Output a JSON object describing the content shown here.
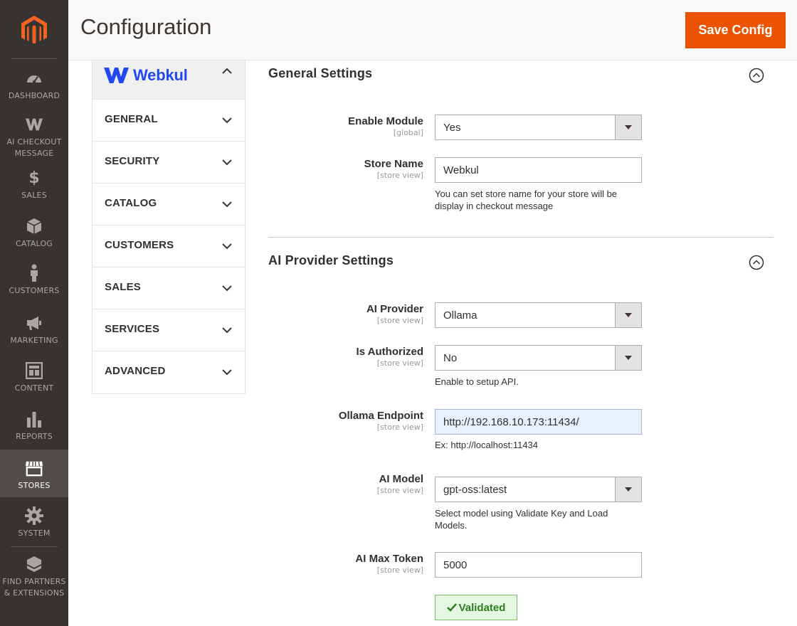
{
  "menu": {
    "items": [
      {
        "label": "DASHBOARD",
        "icon": "dashboard-icon"
      },
      {
        "label": "AI CHECKOUT MESSAGE",
        "icon": "webkul-w-icon"
      },
      {
        "label": "SALES",
        "icon": "dollar-icon"
      },
      {
        "label": "CATALOG",
        "icon": "box-icon"
      },
      {
        "label": "CUSTOMERS",
        "icon": "person-icon"
      },
      {
        "label": "MARKETING",
        "icon": "megaphone-icon"
      },
      {
        "label": "CONTENT",
        "icon": "layout-icon"
      },
      {
        "label": "REPORTS",
        "icon": "bar-chart-icon"
      },
      {
        "label": "STORES",
        "icon": "storefront-icon"
      },
      {
        "label": "SYSTEM",
        "icon": "gear-icon"
      },
      {
        "label": "FIND PARTNERS & EXTENSIONS",
        "icon": "extensions-icon"
      }
    ],
    "active": "STORES"
  },
  "header": {
    "title": "Configuration",
    "save_label": "Save Config"
  },
  "tabs": {
    "brand": "Webkul",
    "items": [
      "GENERAL",
      "SECURITY",
      "CATALOG",
      "CUSTOMERS",
      "SALES",
      "SERVICES",
      "ADVANCED"
    ]
  },
  "general": {
    "title": "General Settings",
    "enable_module": {
      "label": "Enable Module",
      "scope": "[global]",
      "value": "Yes"
    },
    "store_name": {
      "label": "Store Name",
      "scope": "[store view]",
      "value": "Webkul",
      "note": "You can set store name for your store will be display in checkout message"
    }
  },
  "ai": {
    "title": "AI Provider Settings",
    "provider": {
      "label": "AI Provider",
      "scope": "[store view]",
      "value": "Ollama"
    },
    "authorized": {
      "label": "Is Authorized",
      "scope": "[store view]",
      "value": "No",
      "note": "Enable to setup API."
    },
    "endpoint": {
      "label": "Ollama Endpoint",
      "scope": "[store view]",
      "value": "http://192.168.10.173:11434/",
      "note": "Ex: http://localhost:11434"
    },
    "model": {
      "label": "AI Model",
      "scope": "[store view]",
      "value": "gpt-oss:latest",
      "note": "Select model using Validate Key and Load Models."
    },
    "max_token": {
      "label": "AI Max Token",
      "scope": "[store view]",
      "value": "5000"
    },
    "validated_label": "Validated"
  },
  "colors": {
    "menu_bg": "#373330",
    "accent": "#eb5202",
    "brand_blue": "#2149f3",
    "validated_green": "#2e7d1f"
  }
}
